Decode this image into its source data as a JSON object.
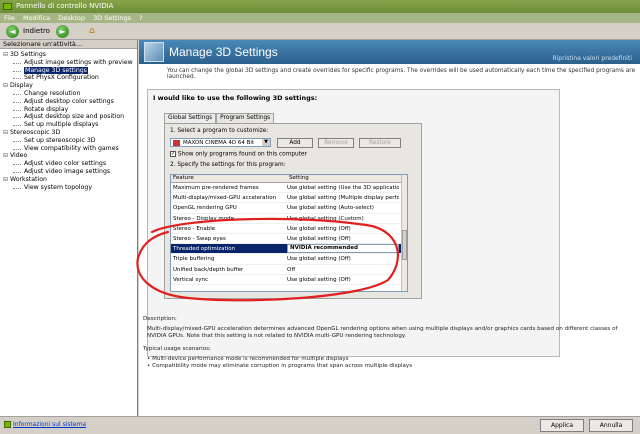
{
  "window": {
    "title": "Pannello di controllo NVIDIA"
  },
  "menu": [
    "File",
    "Modifica",
    "Desktop",
    "3D Settings",
    "?"
  ],
  "toolbar": {
    "back_label": "Indietro",
    "back_glyph": "◄",
    "forward_glyph": "►",
    "home_glyph": "⌂"
  },
  "sidebar": {
    "header": "Selezionare un'attività...",
    "tree": [
      {
        "type": "cat",
        "label": "3D Settings"
      },
      {
        "type": "item",
        "label": "Adjust image settings with preview"
      },
      {
        "type": "item",
        "label": "Manage 3D settings",
        "selected": true
      },
      {
        "type": "item",
        "label": "Set PhysX Configuration"
      },
      {
        "type": "cat",
        "label": "Display"
      },
      {
        "type": "item",
        "label": "Change resolution"
      },
      {
        "type": "item",
        "label": "Adjust desktop color settings"
      },
      {
        "type": "item",
        "label": "Rotate display"
      },
      {
        "type": "item",
        "label": "Adjust desktop size and position"
      },
      {
        "type": "item",
        "label": "Set up multiple displays"
      },
      {
        "type": "cat",
        "label": "Stereoscopic 3D"
      },
      {
        "type": "item",
        "label": "Set up stereoscopic 3D"
      },
      {
        "type": "item",
        "label": "View compatibility with games"
      },
      {
        "type": "cat",
        "label": "Video"
      },
      {
        "type": "item",
        "label": "Adjust video color settings"
      },
      {
        "type": "item",
        "label": "Adjust video image settings"
      },
      {
        "type": "cat",
        "label": "Workstation"
      },
      {
        "type": "item",
        "label": "View system topology"
      }
    ]
  },
  "main": {
    "title": "Manage 3D Settings",
    "restore_defaults": "Ripristina valori predefiniti",
    "intro": "You can change the global 3D settings and create overrides for specific programs. The overrides will be used automatically each time the specified programs are launched.",
    "panel_title": "I would like to use the following 3D settings:",
    "tabs": [
      "Global Settings",
      "Program Settings"
    ],
    "step1": "1. Select a program to customize:",
    "program_selected": "MAXON CINEMA 4D 64 Bit",
    "add_label": "Add",
    "remove_label": "Remove",
    "restore_label": "Restore",
    "show_only_label": "Show only programs found on this computer",
    "show_only_checked": true,
    "step2": "2. Specify the settings for this program:",
    "columns": [
      "Feature",
      "Setting"
    ],
    "settings": [
      {
        "feature": "Maximum pre-rendered frames",
        "setting": "Use global setting (Use the 3D application ..."
      },
      {
        "feature": "Multi-display/mixed-GPU acceleration",
        "setting": "Use global setting (Multiple display perfor..."
      },
      {
        "feature": "OpenGL rendering GPU",
        "setting": "Use global setting (Auto-select)"
      },
      {
        "feature": "Stereo - Display mode",
        "setting": "Use global setting (Custom)"
      },
      {
        "feature": "Stereo - Enable",
        "setting": "Use global setting (Off)"
      },
      {
        "feature": "Stereo - Swap eyes",
        "setting": "Use global setting (Off)"
      },
      {
        "feature": "Threaded optimization",
        "setting": "NVIDIA recommended",
        "highlighted": true
      },
      {
        "feature": "Triple buffering",
        "setting": "Use global setting (Off)"
      },
      {
        "feature": "Unified back/depth buffer",
        "setting": "Off"
      },
      {
        "feature": "Vertical sync",
        "setting": "Use global setting (Off)"
      }
    ],
    "description_heading": "Description:",
    "description": "Multi-display/mixed-GPU acceleration determines advanced OpenGL rendering options when using multiple displays and/or graphics cards based on different classes of NVIDIA GPUs. Note that this setting is not related to NVIDIA multi-GPU rendering technology.",
    "scenarios_heading": "Typical usage scenarios:",
    "scenarios": [
      "Multi-device performance mode is recommended for multiple displays",
      "Compatibility mode may eliminate corruption in programs that span across multiple displays"
    ]
  },
  "footer": {
    "system_info": "Informazioni sul sistema",
    "apply": "Applica",
    "cancel": "Annulla"
  },
  "colors": {
    "nvidia_green": "#76b900",
    "selection": "#0a246a",
    "annotation_red": "#e02020"
  }
}
